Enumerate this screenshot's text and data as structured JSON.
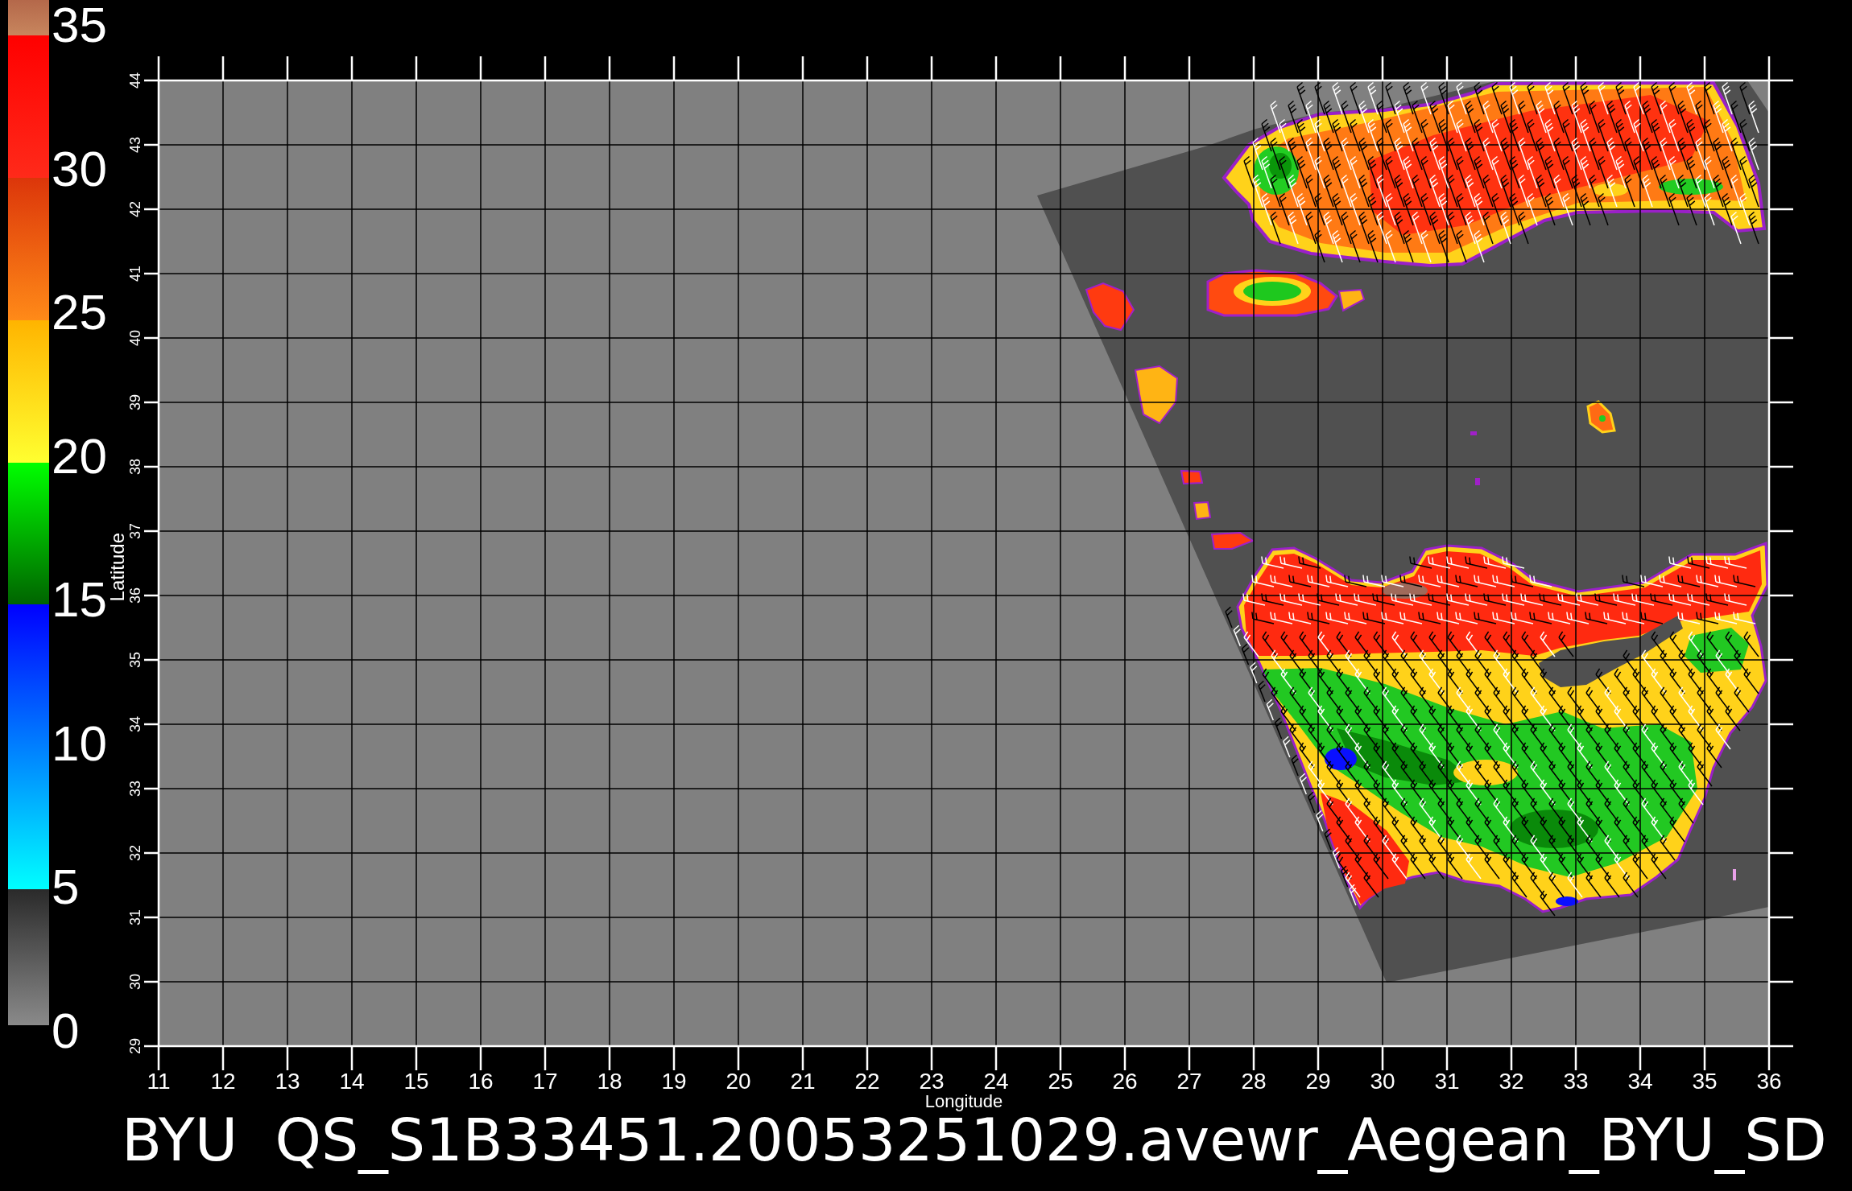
{
  "color_scale": {
    "tick_labels": [
      "35",
      "30",
      "25",
      "20",
      "15",
      "10",
      "5",
      "0"
    ]
  },
  "map": {
    "y_axis_title": "Latitude",
    "y_tick_labels": [
      "44",
      "43",
      "42",
      "41",
      "40",
      "39",
      "38",
      "37",
      "36",
      "35",
      "34",
      "33",
      "32",
      "31",
      "30",
      "29"
    ],
    "x_tick_labels": [
      "11",
      "12",
      "13",
      "14",
      "15",
      "16",
      "17",
      "18",
      "19",
      "20",
      "21",
      "22",
      "23",
      "24",
      "25",
      "26",
      "27",
      "28",
      "29",
      "30",
      "31",
      "32",
      "33",
      "34",
      "35",
      "36"
    ],
    "x_axis_title": "Longitude"
  },
  "title": "BYU  QS_S1B33451.20053251029.avewr_Aegean_BYU_SD"
}
